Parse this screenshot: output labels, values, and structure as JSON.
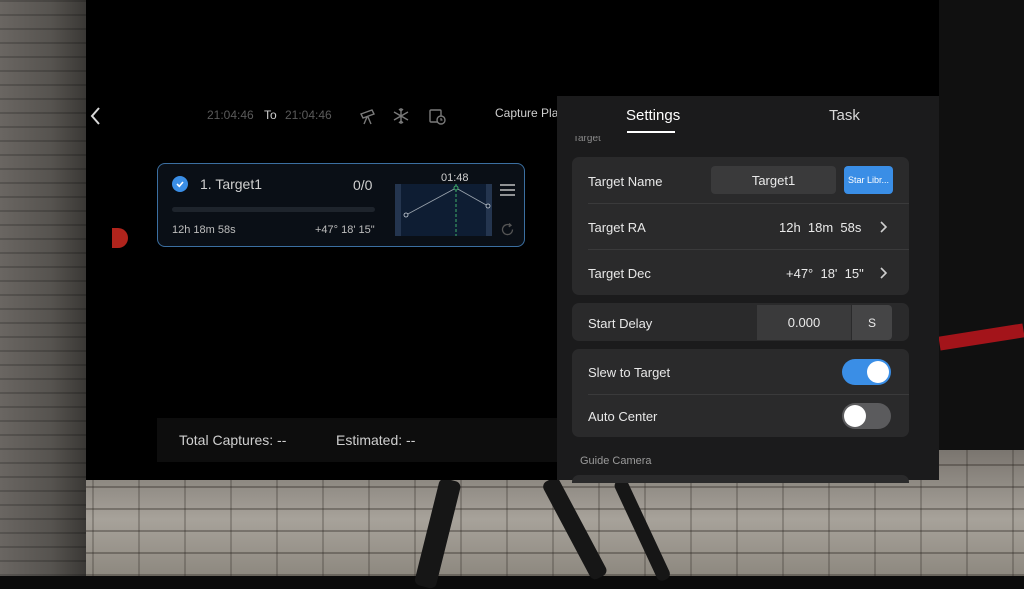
{
  "header": {
    "start_time": "21:04:46",
    "to_label": "To",
    "end_time": "21:04:46",
    "capture_plan_label": "Capture Plan",
    "icons": [
      "telescope-icon",
      "snowflake-icon",
      "calendar-clock-icon"
    ]
  },
  "target_card": {
    "name": "1. Target1",
    "count": "0/0",
    "ra": "12h 18m 58s",
    "dec": "+47° 18' 15\"",
    "chart_time": "01:48",
    "progress": 0
  },
  "footer": {
    "total_captures": "Total Captures: --",
    "estimated": "Estimated: --"
  },
  "settings": {
    "tabs": [
      {
        "label": "Settings",
        "active": true
      },
      {
        "label": "Task",
        "active": false
      }
    ],
    "section_target": "Target",
    "target_name_label": "Target Name",
    "target_name_value": "Target1",
    "star_library_label": "Star Libr...",
    "target_ra_label": "Target RA",
    "target_ra_value": "12h  18m  58s",
    "target_dec_label": "Target Dec",
    "target_dec_value": "+47°  18'  15\"",
    "start_delay_label": "Start Delay",
    "start_delay_value": "0.000",
    "start_delay_unit": "S",
    "slew_label": "Slew to Target",
    "slew_enabled": true,
    "auto_center_label": "Auto Center",
    "auto_center_enabled": false,
    "section_guide": "Guide Camera"
  },
  "colors": {
    "accent": "#3a8ee6",
    "card_border": "#3b6fa1",
    "panel_bg": "#1b1b1c",
    "group_bg": "#2a2a2b"
  }
}
